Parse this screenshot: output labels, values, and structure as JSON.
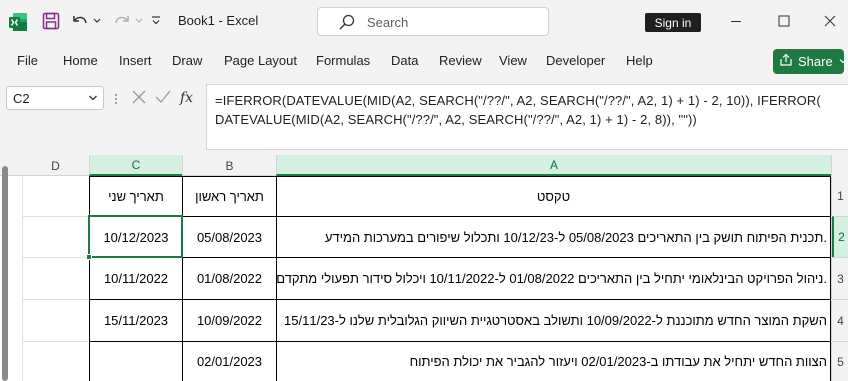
{
  "titlebar": {
    "doc_title": "Book1  -  Excel",
    "search_placeholder": "Search",
    "signin_label": "Sign in"
  },
  "menu": {
    "items": [
      "File",
      "Home",
      "Insert",
      "Draw",
      "Page Layout",
      "Formulas",
      "Data",
      "Review",
      "View",
      "Developer",
      "Help"
    ],
    "share_label": "Share"
  },
  "formula_bar": {
    "name_box": "C2",
    "formula": "=IFERROR(DATEVALUE(MID(A2, SEARCH(\"/??/\", A2, SEARCH(\"/??/\", A2, 1) + 1) - 2, 10)), IFERROR(\nDATEVALUE(MID(A2, SEARCH(\"/??/\", A2, SEARCH(\"/??/\", A2, 1) + 1) - 2, 8)), \"\"))"
  },
  "sheet": {
    "columns": [
      "D",
      "C",
      "B",
      "A"
    ],
    "selected_column": "C",
    "rows": [
      "1",
      "2",
      "3",
      "4",
      "5"
    ],
    "selected_row": "2",
    "header": {
      "A": "טקסט",
      "B": "תאריך ראשון",
      "C": "תאריך שני"
    },
    "data": [
      {
        "A": "תכנית הפיתוח תושק בין התאריכים 05/08/2023 ל-10/12/23 ותכלול שיפורים במערכות המידע.",
        "B": "05/08/2023",
        "C": "10/12/2023"
      },
      {
        "A": "ניהול הפרויקט הבינלאומי יתחיל בין התאריכים 01/08/2022 ל-10/11/2022 ויכלול סידור תפעולי מתקדם.",
        "B": "01/08/2022",
        "C": "10/11/2022"
      },
      {
        "A": "השקת המוצר החדש מתוכננת ל-10/09/2022 ותשולב באסטרטגיית השיווק הגלובלית שלנו ל-15/11/23",
        "B": "10/09/2022",
        "C": "15/11/2023"
      },
      {
        "A": "הצוות החדש יתחיל את עבודתו ב-02/01/2023 ויעזור להגביר את יכולת הפיתוח",
        "B": "02/01/2023",
        "C": ""
      }
    ]
  },
  "colors": {
    "excel_green": "#1e7a42",
    "share_green": "#1f7a41",
    "selected_header_bg": "#d3f0e0"
  }
}
